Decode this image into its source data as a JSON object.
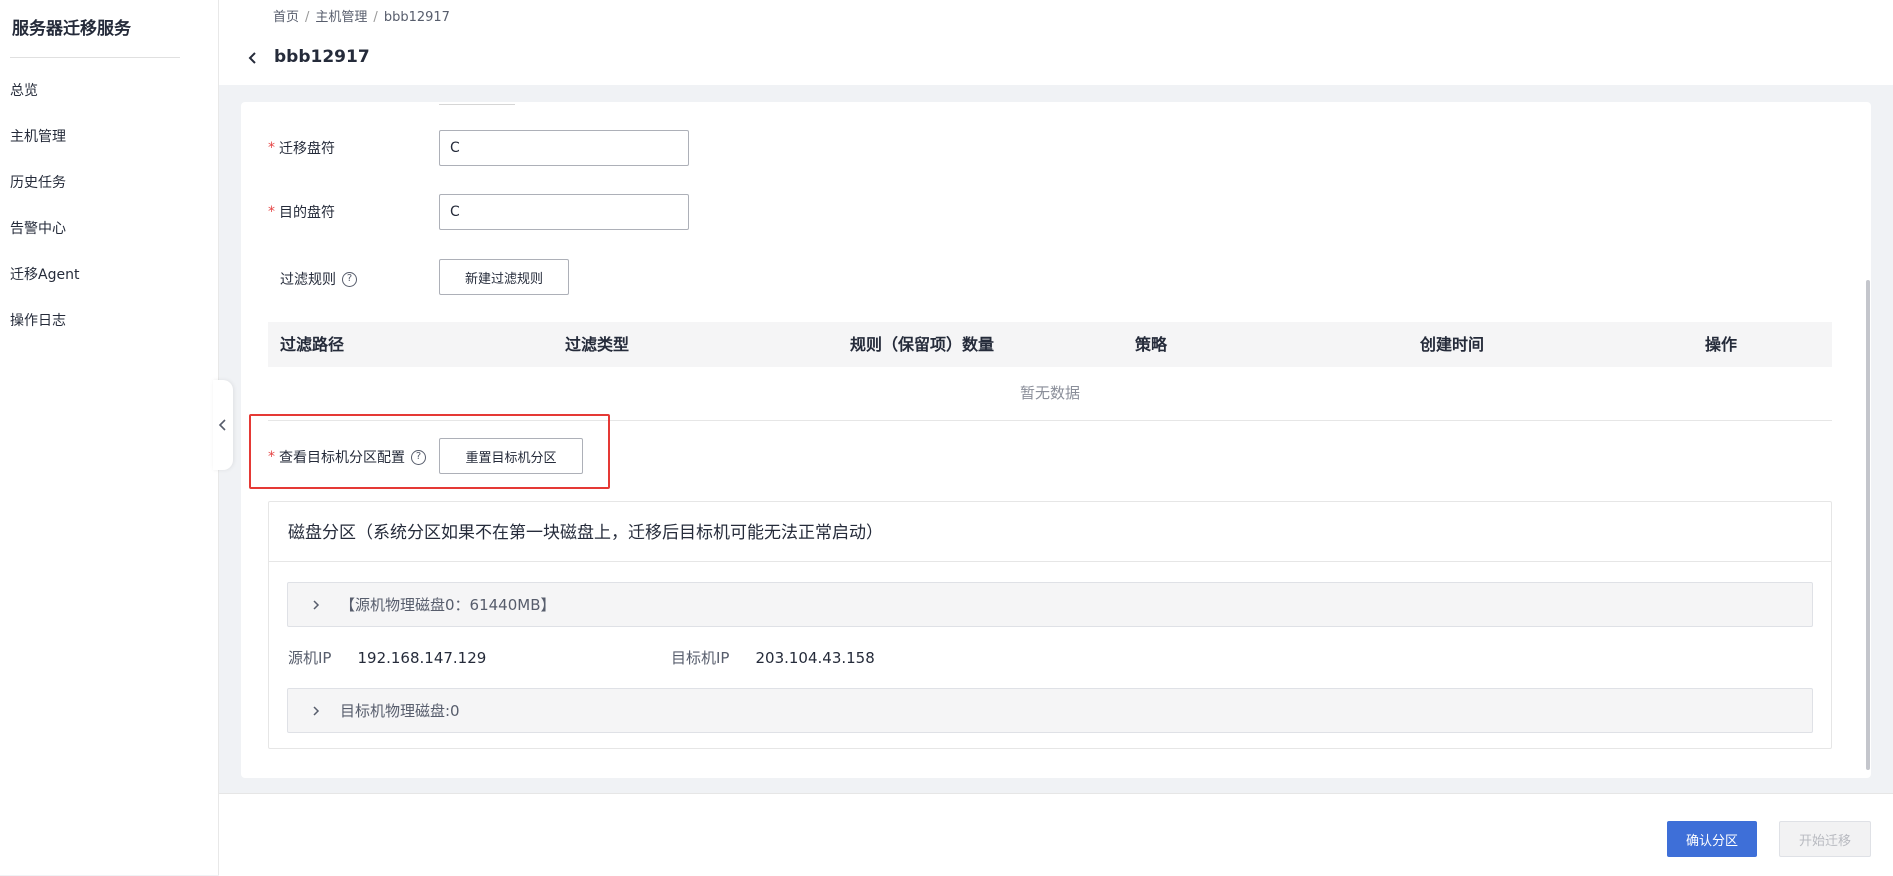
{
  "sidebar": {
    "brand": "服务器迁移服务",
    "items": [
      {
        "label": "总览"
      },
      {
        "label": "主机管理"
      },
      {
        "label": "历史任务"
      },
      {
        "label": "告警中心"
      },
      {
        "label": "迁移Agent"
      },
      {
        "label": "操作日志"
      }
    ]
  },
  "breadcrumb": {
    "home": "首页",
    "host": "主机管理",
    "current": "bbb12917",
    "sep": "/"
  },
  "header": {
    "title": "bbb12917"
  },
  "form": {
    "source_drive": {
      "label": "迁移盘符",
      "value": "C"
    },
    "target_drive": {
      "label": "目的盘符",
      "value": "C"
    },
    "filter_rules": {
      "label": "过滤规则",
      "button": "新建过滤规则"
    },
    "help_glyph": "?",
    "required_mark": "*"
  },
  "filter_table": {
    "columns": [
      "过滤路径",
      "过滤类型",
      "规则（保留项）数量",
      "策略",
      "创建时间",
      "操作"
    ],
    "empty_text": "暂无数据"
  },
  "partition_config": {
    "label": "查看目标机分区配置",
    "reset_button": "重置目标机分区"
  },
  "disk_panel": {
    "title": "磁盘分区（系统分区如果不在第一块磁盘上，迁移后目标机可能无法正常启动）",
    "source_disk": "【源机物理磁盘0：61440MB】",
    "source_ip_label": "源机IP",
    "source_ip": "192.168.147.129",
    "target_ip_label": "目标机IP",
    "target_ip": "203.104.43.158",
    "target_disk": "目标机物理磁盘:0"
  },
  "footer": {
    "confirm_button": "确认分区",
    "start_button": "开始迁移"
  },
  "colors": {
    "primary": "#3e6fd8",
    "required": "#e54545",
    "highlight": "#e53935"
  }
}
